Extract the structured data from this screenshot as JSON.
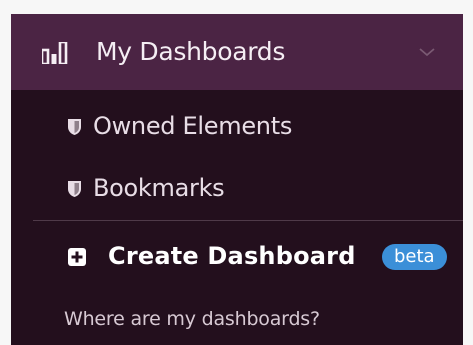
{
  "header": {
    "title": "My Dashboards",
    "icon": "bar-chart-icon",
    "toggle_icon": "chevron-down-icon"
  },
  "menu": {
    "items": [
      {
        "label": "Owned Elements",
        "icon": "shield-icon"
      },
      {
        "label": "Bookmarks",
        "icon": "shield-icon"
      }
    ],
    "create": {
      "label": "Create Dashboard",
      "icon": "plus-square-icon",
      "badge": "beta"
    },
    "help_link": "Where are my dashboards?"
  },
  "colors": {
    "header_bg": "#4b2444",
    "panel_bg": "#230f1d",
    "badge_bg": "#3b8fd8",
    "text": "#e8dde6"
  }
}
